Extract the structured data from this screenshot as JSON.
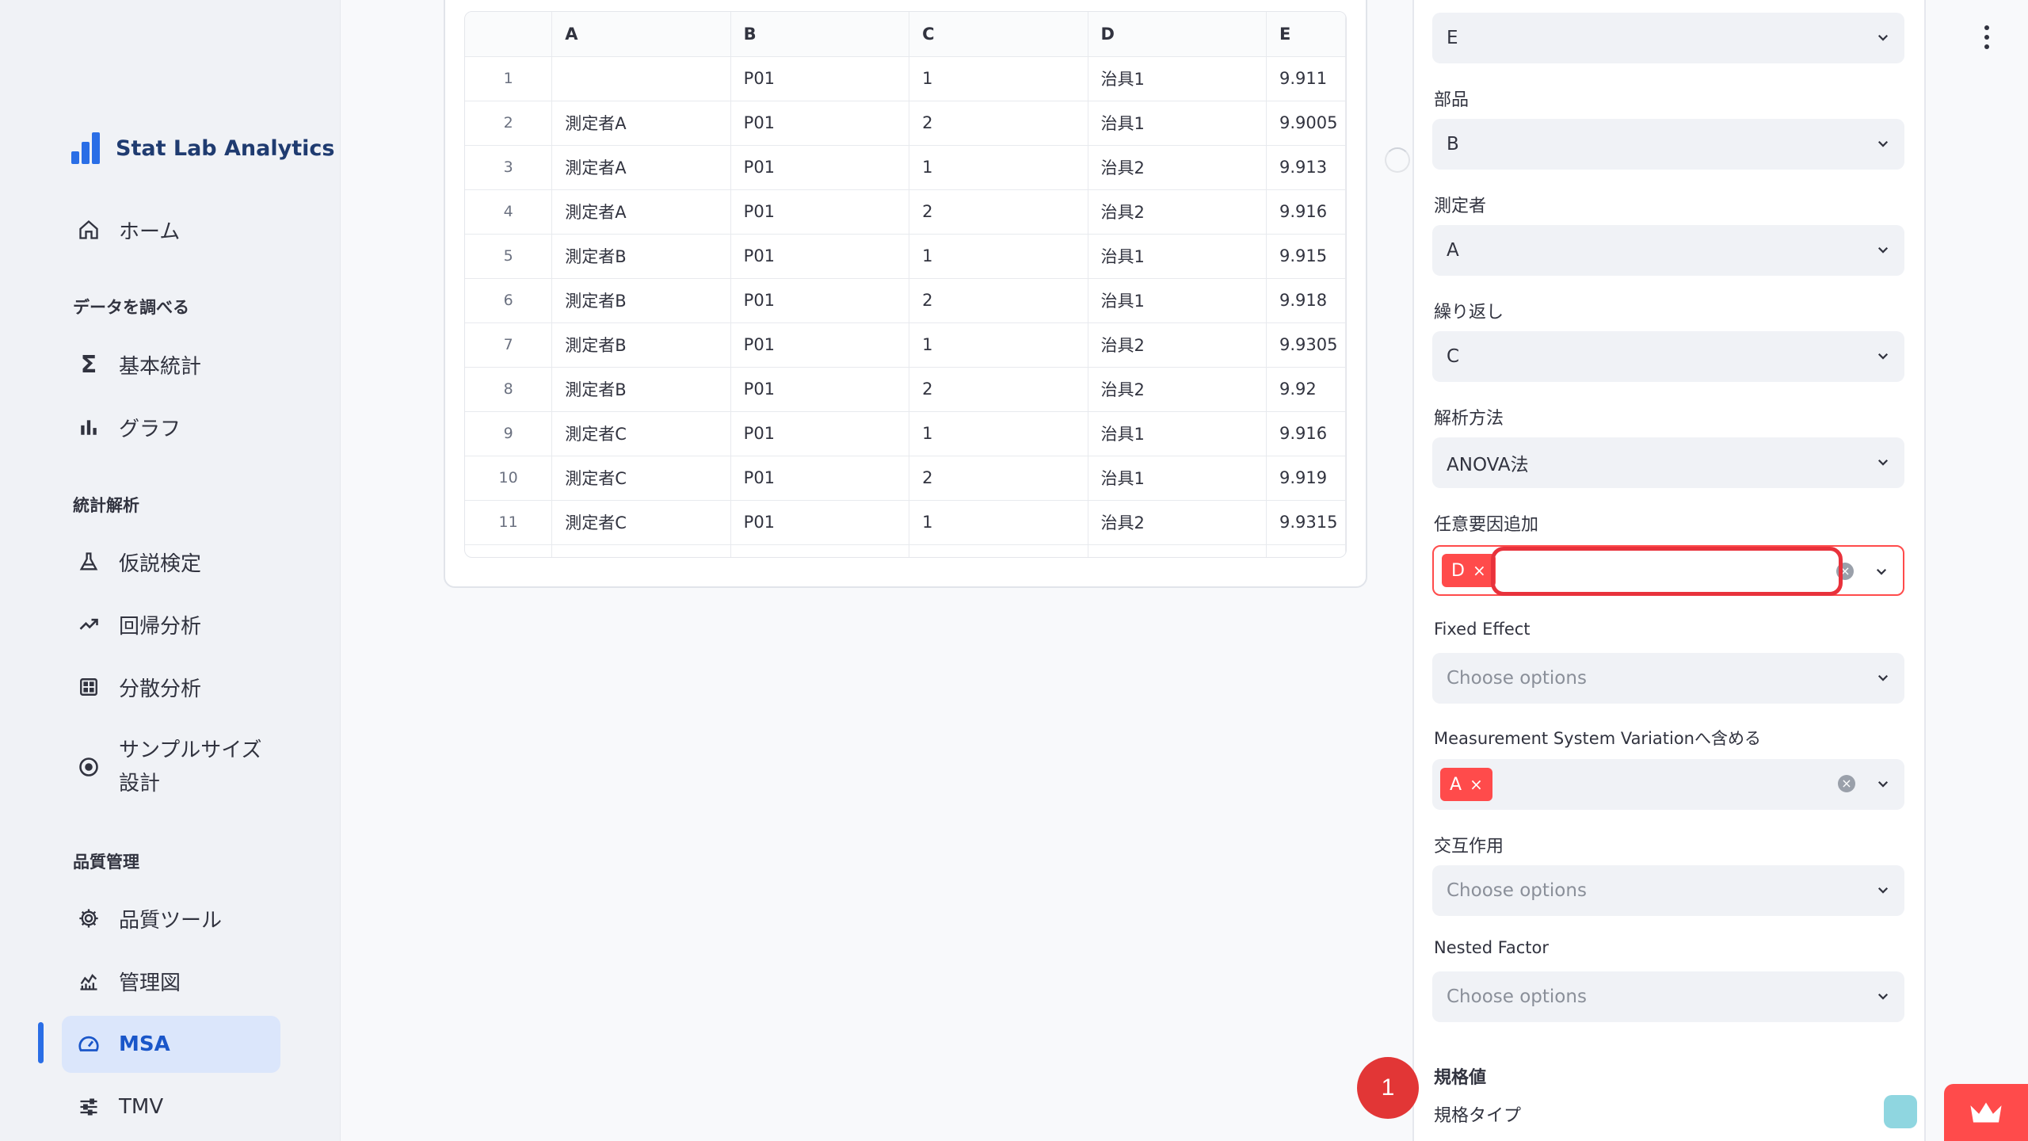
{
  "brand": {
    "title": "Stat Lab Analytics",
    "color": "#2a6ee6"
  },
  "nav": {
    "home": "ホーム",
    "section_explore": "データを調べる",
    "basic_stats": "基本統計",
    "graph": "グラフ",
    "section_analysis": "統計解析",
    "hypothesis": "仮説検定",
    "regression": "回帰分析",
    "anova": "分散分析",
    "sample_size": "サンプルサイズ設計",
    "section_quality": "品質管理",
    "quality_tools": "品質ツール",
    "control_chart": "管理図",
    "msa": "MSA",
    "tmv": "TMV"
  },
  "table": {
    "columns": [
      "",
      "A",
      "B",
      "C",
      "D",
      "E"
    ],
    "rows": [
      [
        "1",
        "",
        "P01",
        "1",
        "治具1",
        "9.911"
      ],
      [
        "2",
        "測定者A",
        "P01",
        "2",
        "治具1",
        "9.9005"
      ],
      [
        "3",
        "測定者A",
        "P01",
        "1",
        "治具2",
        "9.913"
      ],
      [
        "4",
        "測定者A",
        "P01",
        "2",
        "治具2",
        "9.916"
      ],
      [
        "5",
        "測定者B",
        "P01",
        "1",
        "治具1",
        "9.915"
      ],
      [
        "6",
        "測定者B",
        "P01",
        "2",
        "治具1",
        "9.918"
      ],
      [
        "7",
        "測定者B",
        "P01",
        "1",
        "治具2",
        "9.9305"
      ],
      [
        "8",
        "測定者B",
        "P01",
        "2",
        "治具2",
        "9.92"
      ],
      [
        "9",
        "測定者C",
        "P01",
        "1",
        "治具1",
        "9.916"
      ],
      [
        "10",
        "測定者C",
        "P01",
        "2",
        "治具1",
        "9.919"
      ],
      [
        "11",
        "測定者C",
        "P01",
        "1",
        "治具2",
        "9.9315"
      ]
    ]
  },
  "panel": {
    "measure_value": "E",
    "part_label": "部品",
    "part_value": "B",
    "operator_label": "測定者",
    "operator_value": "A",
    "repeat_label": "繰り返し",
    "repeat_value": "C",
    "method_label": "解析方法",
    "method_value": "ANOVA法",
    "extra_factor_label": "任意要因追加",
    "extra_factor_chip": "D",
    "fixed_effect_label": "Fixed Effect",
    "fixed_effect_placeholder": "Choose options",
    "msv_label": "Measurement System Variationへ含める",
    "msv_chip": "A",
    "interaction_label": "交互作用",
    "interaction_placeholder": "Choose options",
    "nested_label": "Nested Factor",
    "nested_placeholder": "Choose options",
    "spec_section": "規格値",
    "spec_type_label": "規格タイプ"
  },
  "badge": {
    "count": "1"
  },
  "colors": {
    "accent": "#ff4b4b",
    "primary": "#2a6ee6",
    "highlight": "#e8323c"
  }
}
